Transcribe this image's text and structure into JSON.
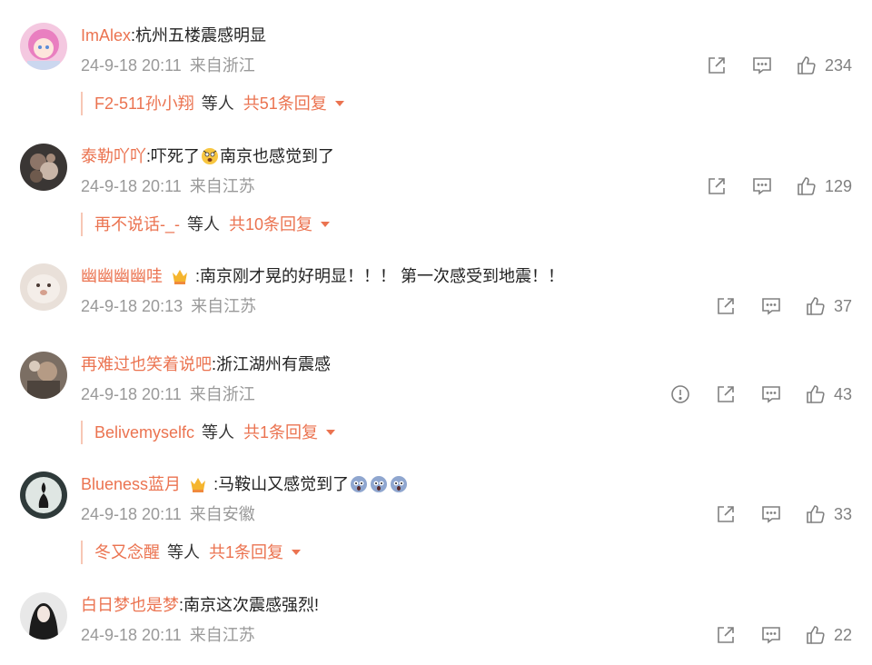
{
  "comments": [
    {
      "user": "ImAlex",
      "text": ":杭州五楼震感明显",
      "time": "24-9-18 20:11",
      "location": "来自浙江",
      "likes": "234",
      "reply_user": "F2-511孙小翔",
      "reply_etc": "等人",
      "reply_count": "共51条回复"
    },
    {
      "user": "泰勒吖吖",
      "text_a": ":吓死了",
      "text_b": "南京也感觉到了",
      "time": "24-9-18 20:11",
      "location": "来自江苏",
      "likes": "129",
      "reply_user": "再不说话-_-",
      "reply_etc": "等人",
      "reply_count": "共10条回复"
    },
    {
      "user": "幽幽幽幽哇",
      "text": ":南京刚才晃的好明显！！！ 第一次感受到地震！！",
      "time": "24-9-18 20:13",
      "location": "来自江苏",
      "likes": "37"
    },
    {
      "user": "再难过也笑着说吧",
      "text": ":浙江湖州有震感",
      "time": "24-9-18 20:11",
      "location": "来自浙江",
      "likes": "43",
      "reply_user": "Belivemyselfc",
      "reply_etc": "等人",
      "reply_count": "共1条回复"
    },
    {
      "user": "Blueness蓝月",
      "text": ":马鞍山又感觉到了",
      "time": "24-9-18 20:11",
      "location": "来自安徽",
      "likes": "33",
      "reply_user": "冬又念醒",
      "reply_etc": "等人",
      "reply_count": "共1条回复"
    },
    {
      "user": "白日梦也是梦",
      "text": ":南京这次震感强烈!",
      "time": "24-9-18 20:11",
      "location": "来自江苏",
      "likes": "22"
    }
  ],
  "colors": {
    "username": "#eb7350",
    "meta": "#999999",
    "icon": "#808080",
    "reply_line": "#f7c7b5"
  },
  "icons": [
    "share-icon",
    "comment-icon",
    "thumbs-up-icon",
    "report-icon",
    "caret-down-icon",
    "crown-badge-icon",
    "emoji-icon"
  ]
}
